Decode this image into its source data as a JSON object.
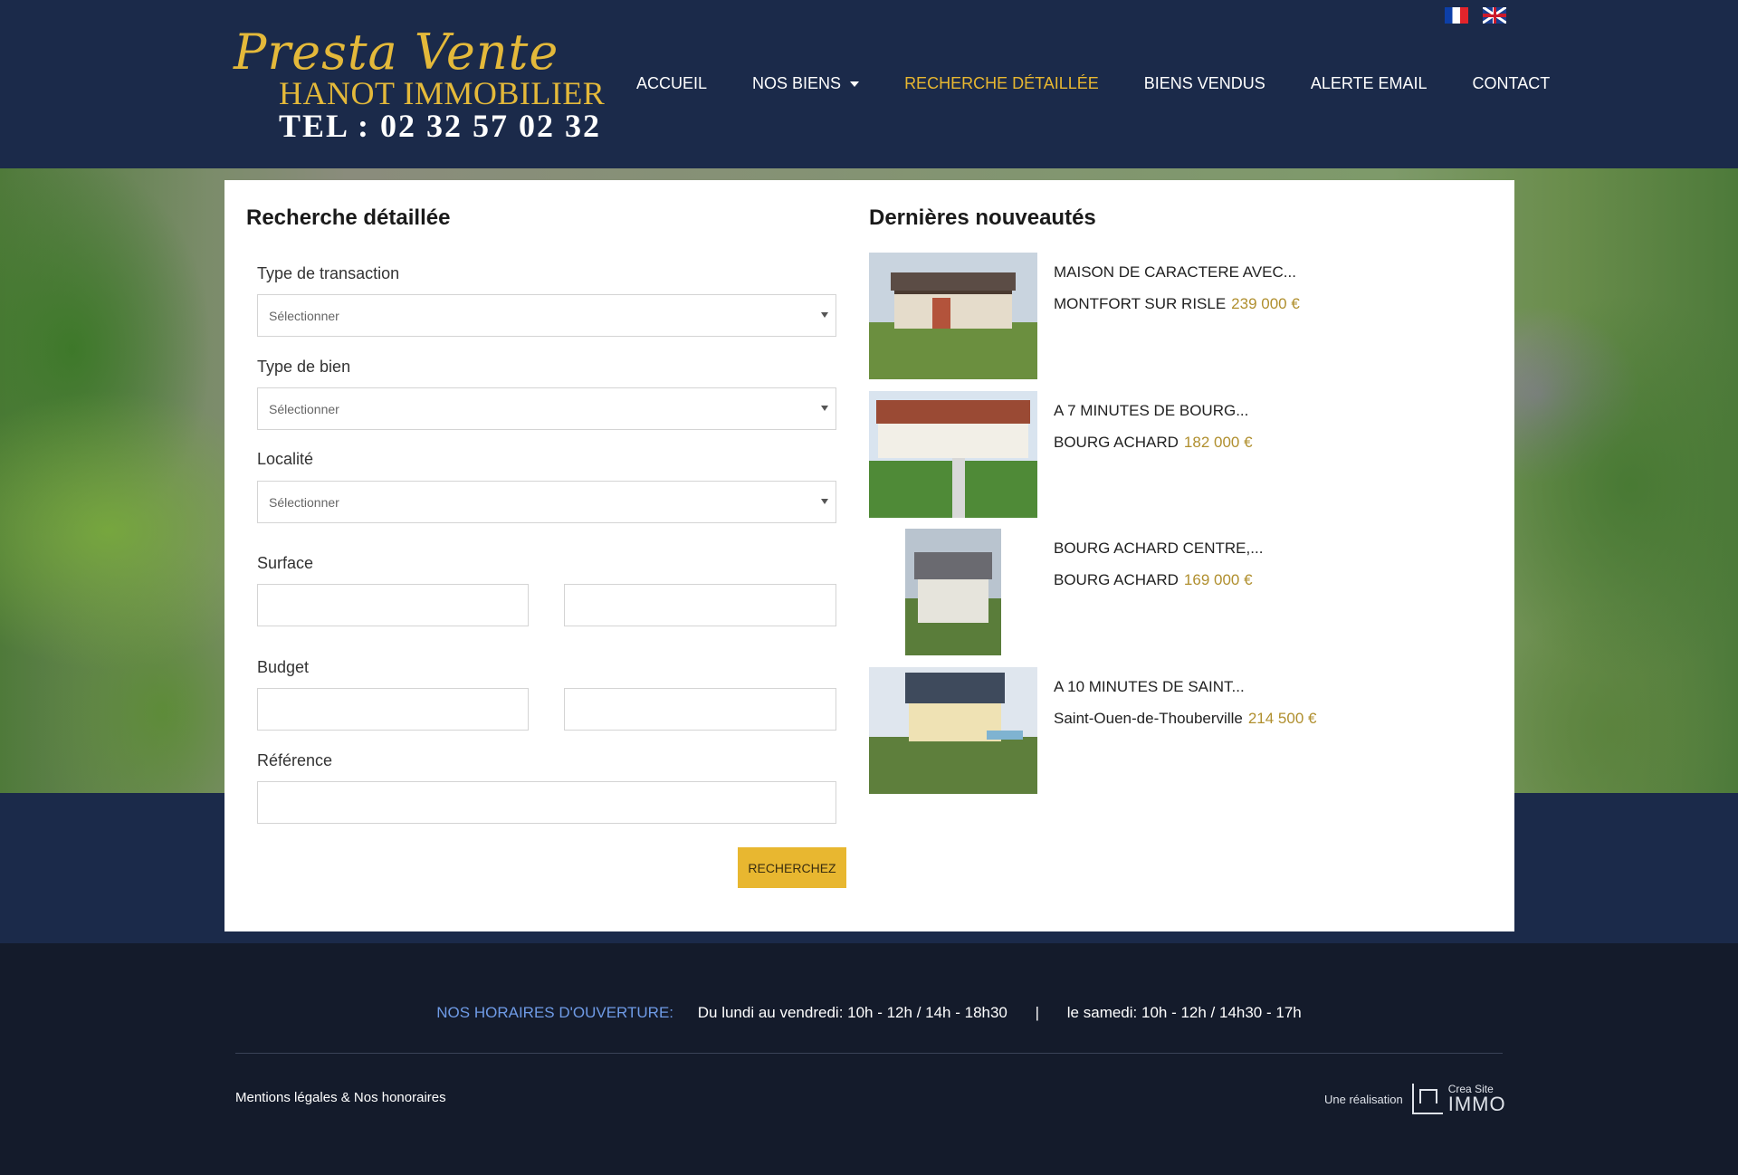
{
  "header": {
    "logo": {
      "script": "Presta Vente",
      "name": "HANOT IMMOBILIER",
      "tel": "TEL : 02 32 57 02 32"
    },
    "languages": [
      {
        "code": "fr",
        "icon": "flag-fr-icon"
      },
      {
        "code": "en",
        "icon": "flag-uk-icon"
      }
    ],
    "nav": [
      {
        "label": "ACCUEIL",
        "active": false
      },
      {
        "label": "NOS BIENS",
        "active": false,
        "dropdown": true
      },
      {
        "label": "RECHERCHE DÉTAILLÉE",
        "active": true
      },
      {
        "label": "BIENS VENDUS",
        "active": false
      },
      {
        "label": "ALERTE EMAIL",
        "active": false
      },
      {
        "label": "CONTACT",
        "active": false
      }
    ]
  },
  "search": {
    "title": "Recherche détaillée",
    "transaction_label": "Type de transaction",
    "transaction_value": "Sélectionner",
    "bien_label": "Type de bien",
    "bien_value": "Sélectionner",
    "localite_label": "Localité",
    "localite_value": "Sélectionner",
    "surface_label": "Surface",
    "budget_label": "Budget",
    "reference_label": "Référence",
    "submit_label": "RECHERCHEZ"
  },
  "news": {
    "title": "Dernières nouveautés",
    "items": [
      {
        "title": "MAISON DE CARACTERE AVEC...",
        "location": "MONTFORT SUR RISLE",
        "price": "239 000 €"
      },
      {
        "title": "A 7 MINUTES DE BOURG...",
        "location": "BOURG ACHARD",
        "price": "182 000 €"
      },
      {
        "title": "BOURG ACHARD CENTRE,...",
        "location": "BOURG ACHARD",
        "price": "169 000 €"
      },
      {
        "title": "A 10 MINUTES DE SAINT...",
        "location": "Saint-Ouen-de-Thouberville",
        "price": "214 500 €"
      }
    ]
  },
  "footer": {
    "hours_label": "NOS HORAIRES D'OUVERTURE:",
    "weekdays": "Du lundi au vendredi: 10h - 12h / 14h - 18h30",
    "separator": "|",
    "saturday": "le samedi: 10h - 12h / 14h30 - 17h",
    "legal": "Mentions légales & Nos honoraires",
    "credit_prefix": "Une réalisation",
    "credit_brand_top": "Crea Site",
    "credit_brand_bottom": "IMMO"
  },
  "colors": {
    "navy": "#1b2a4a",
    "gold": "#e8b730",
    "footer_bg": "#141b2b",
    "hours_accent": "#6f9be6",
    "price": "#b08f2e"
  }
}
